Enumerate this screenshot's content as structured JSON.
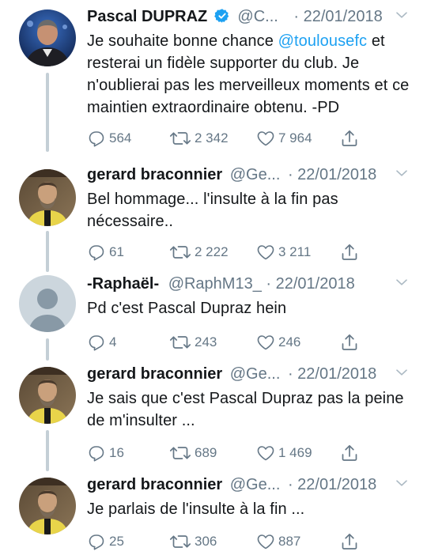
{
  "tweets": [
    {
      "name": "Pascal DUPRAZ",
      "handle": "@C...",
      "date": "· 22/01/2018",
      "verified": true,
      "text_parts": [
        "Je souhaite bonne chance ",
        "@toulousefc",
        " et resterai un fidèle supporter du club. Je n'oublierai pas les merveilleux moments et ce maintien extraordinaire obtenu. -PD"
      ],
      "replies": "564",
      "retweets": "2 342",
      "likes": "7 964"
    },
    {
      "name": "gerard braconnier",
      "handle": "@Ge...",
      "date": "· 22/01/2018",
      "text": "Bel hommage... l'insulte à la fin pas nécessaire..",
      "replies": "61",
      "retweets": "2 222",
      "likes": "3 211"
    },
    {
      "name": "-Raphaël-",
      "handle": "@RaphM13_",
      "date": "· 22/01/2018",
      "text": "Pd c'est Pascal Dupraz hein",
      "replies": "4",
      "retweets": "243",
      "likes": "246"
    },
    {
      "name": "gerard braconnier",
      "handle": "@Ge...",
      "date": "· 22/01/2018",
      "text": "Je sais que c'est Pascal Dupraz pas la peine de m'insulter ...",
      "replies": "16",
      "retweets": "689",
      "likes": "1 469"
    },
    {
      "name": "gerard braconnier",
      "handle": "@Ge...",
      "date": "· 22/01/2018",
      "text": "Je parlais de l'insulte à la fin ...",
      "replies": "25",
      "retweets": "306",
      "likes": "887"
    }
  ],
  "colors": {
    "accent": "#1da1f2",
    "muted": "#657786",
    "thread_line": "#c4cfd6"
  },
  "icons": [
    "verified-badge-icon",
    "chevron-down-icon",
    "reply-icon",
    "retweet-icon",
    "like-icon",
    "share-icon"
  ]
}
